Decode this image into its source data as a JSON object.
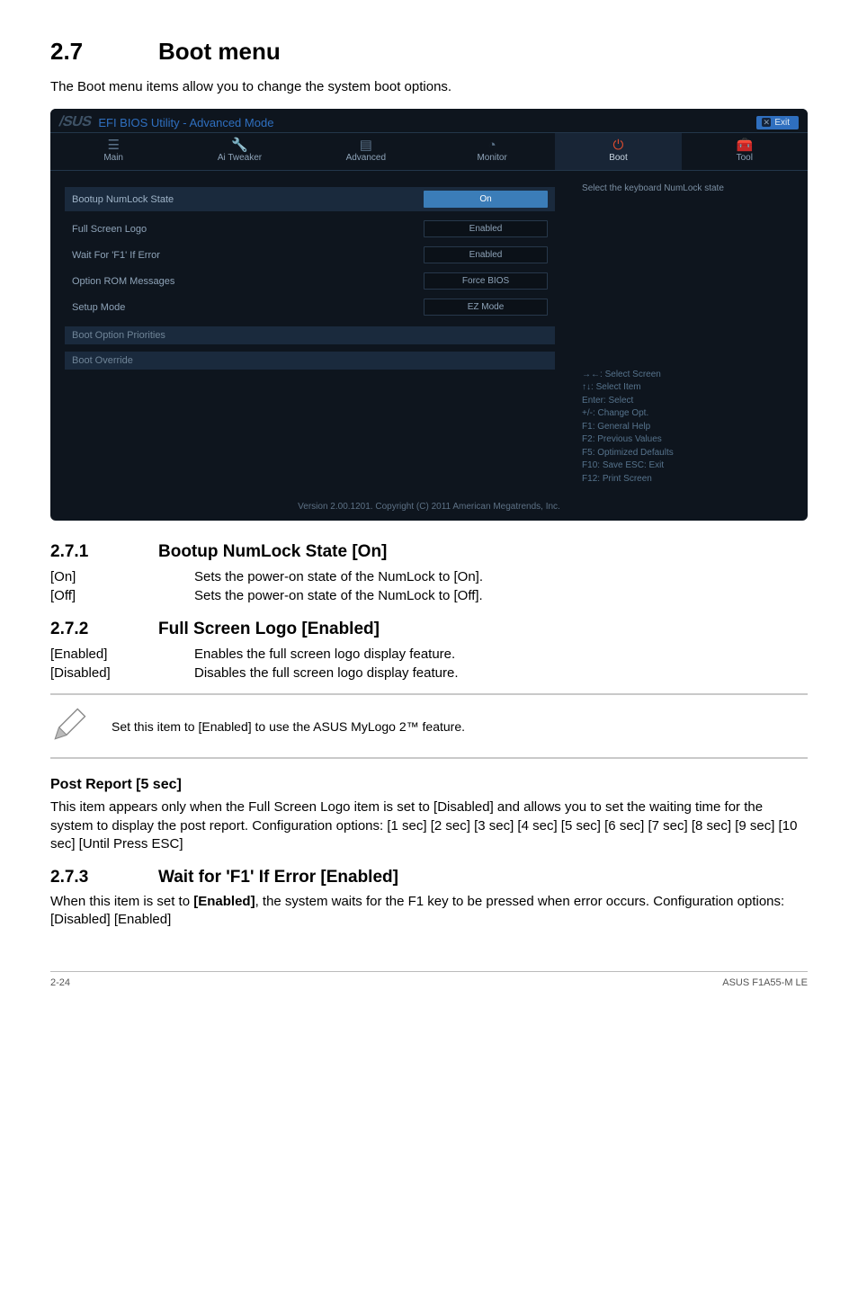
{
  "section": {
    "num": "2.7",
    "title": "Boot menu"
  },
  "intro": "The Boot menu items allow you to change the system boot options.",
  "bios": {
    "logo_text": "/SUS",
    "title": "EFI BIOS Utility - Advanced Mode",
    "exit_label": "Exit",
    "tabs": [
      {
        "label": "Main",
        "icon_name": "list-icon"
      },
      {
        "label": "Ai Tweaker",
        "icon_name": "wrench-icon"
      },
      {
        "label": "Advanced",
        "icon_name": "chip-icon"
      },
      {
        "label": "Monitor",
        "icon_name": "gauge-icon"
      },
      {
        "label": "Boot",
        "icon_name": "power-icon",
        "active": true
      },
      {
        "label": "Tool",
        "icon_name": "toolbox-icon"
      }
    ],
    "rows": [
      {
        "label": "Bootup NumLock State",
        "value": "On",
        "selected": true
      },
      {
        "label": "Full Screen Logo",
        "value": "Enabled"
      },
      {
        "label": "Wait For 'F1' If Error",
        "value": "Enabled"
      },
      {
        "label": "Option ROM Messages",
        "value": "Force BIOS"
      },
      {
        "label": "Setup Mode",
        "value": "EZ Mode"
      }
    ],
    "sections": [
      {
        "label": "Boot Option Priorities"
      },
      {
        "label": "Boot Override"
      }
    ],
    "right_hint": "Select the keyboard NumLock state",
    "help_lines": [
      "→←: Select Screen",
      "↑↓: Select Item",
      "Enter: Select",
      "+/-: Change Opt.",
      "F1: General Help",
      "F2: Previous Values",
      "F5: Optimized Defaults",
      "F10: Save   ESC: Exit",
      "F12: Print Screen"
    ],
    "version": "Version 2.00.1201.  Copyright (C) 2011 American Megatrends, Inc."
  },
  "s271": {
    "num": "2.7.1",
    "title": "Bootup NumLock State [On]",
    "rows": [
      {
        "k": "[On]",
        "v": "Sets the power-on state of the NumLock to [On]."
      },
      {
        "k": "[Off]",
        "v": "Sets the power-on state of the NumLock to [Off]."
      }
    ]
  },
  "s272": {
    "num": "2.7.2",
    "title": "Full Screen Logo [Enabled]",
    "rows": [
      {
        "k": "[Enabled]",
        "v": "Enables the full screen logo display feature."
      },
      {
        "k": "[Disabled]",
        "v": "Disables the full screen logo display feature."
      }
    ]
  },
  "note": "Set this item to [Enabled] to use the ASUS MyLogo 2™ feature.",
  "postreport": {
    "title": "Post Report [5 sec]",
    "body": "This item appears only when the Full Screen Logo item is set to [Disabled] and allows you to set the waiting time for the system to display the post report. Configuration options: [1 sec] [2 sec] [3 sec] [4 sec] [5 sec] [6 sec] [7 sec] [8 sec] [9 sec] [10 sec] [Until Press ESC]"
  },
  "s273": {
    "num": "2.7.3",
    "title": "Wait for 'F1' If Error [Enabled]",
    "body_pre": "When this item is set to ",
    "body_bold": "[Enabled]",
    "body_post": ", the system waits for the F1 key to be pressed when error occurs. Configuration options: [Disabled] [Enabled]"
  },
  "footer": {
    "left": "2-24",
    "right": "ASUS F1A55-M LE"
  }
}
